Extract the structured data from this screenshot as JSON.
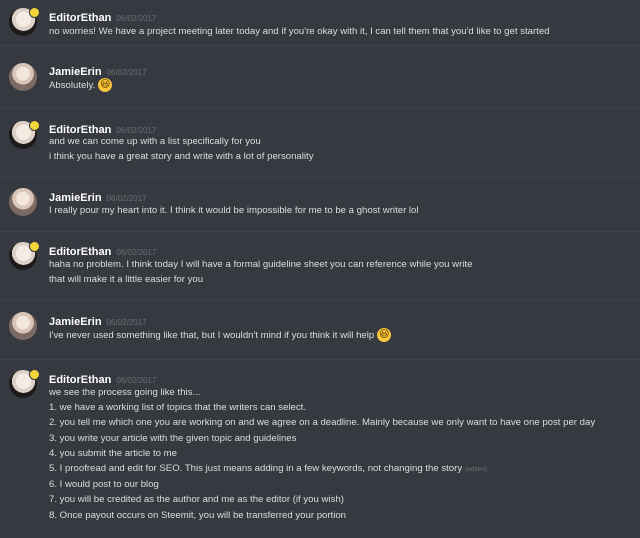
{
  "messages": [
    {
      "user": "EditorEthan",
      "timestamp": "06/02/2017",
      "avatar": "ethan",
      "lines": [
        {
          "text": "no worries! We have a project meeting later today and if you're okay with it, I can tell them that you'd like to get started"
        }
      ]
    },
    {
      "user": "JamieErin",
      "timestamp": "06/02/2017",
      "avatar": "jamie",
      "lines": [
        {
          "text": "Absolutely.",
          "emoji": "😃"
        }
      ]
    },
    {
      "user": "EditorEthan",
      "timestamp": "06/02/2017",
      "avatar": "ethan",
      "lines": [
        {
          "text": "and we can come up with a list specifically for you"
        },
        {
          "text": "i think you have a great story and write with a lot of personality"
        }
      ]
    },
    {
      "user": "JamieErin",
      "timestamp": "06/02/2017",
      "avatar": "jamie",
      "lines": [
        {
          "text": "I really pour my heart into it. I think it would be impossible for me to be a ghost writer lol"
        }
      ]
    },
    {
      "user": "EditorEthan",
      "timestamp": "06/02/2017",
      "avatar": "ethan",
      "lines": [
        {
          "text": "haha no problem. I think today I will have a formal guideline sheet you can reference while you write"
        },
        {
          "text": "that will make it a little easier for you"
        }
      ]
    },
    {
      "user": "JamieErin",
      "timestamp": "06/02/2017",
      "avatar": "jamie",
      "lines": [
        {
          "text": "I've never used something like that, but I wouldn't mind if you think it will help",
          "emoji": "😃"
        }
      ]
    },
    {
      "user": "EditorEthan",
      "timestamp": "06/02/2017",
      "avatar": "ethan",
      "lines": [
        {
          "text": "we see the process going like this..."
        },
        {
          "text": "1. we have a working list of topics that the writers can select."
        },
        {
          "text": "2. you tell me which one you are working on and we agree on a deadline. Mainly because we only want to have one post per day"
        },
        {
          "text": "3. you write your article with the given topic and guidelines"
        },
        {
          "text": "4. you submit the article to me"
        },
        {
          "text": "5. I proofread and edit for SEO. This just means adding in a few keywords, not changing the story",
          "edited": "(edited)"
        },
        {
          "text": "6. I would post to our blog"
        },
        {
          "text": "7. you will be credited as the author and me as the editor (if you wish)"
        },
        {
          "text": "8. Once payout occurs on Steemit, you will be transferred your portion"
        }
      ]
    }
  ]
}
